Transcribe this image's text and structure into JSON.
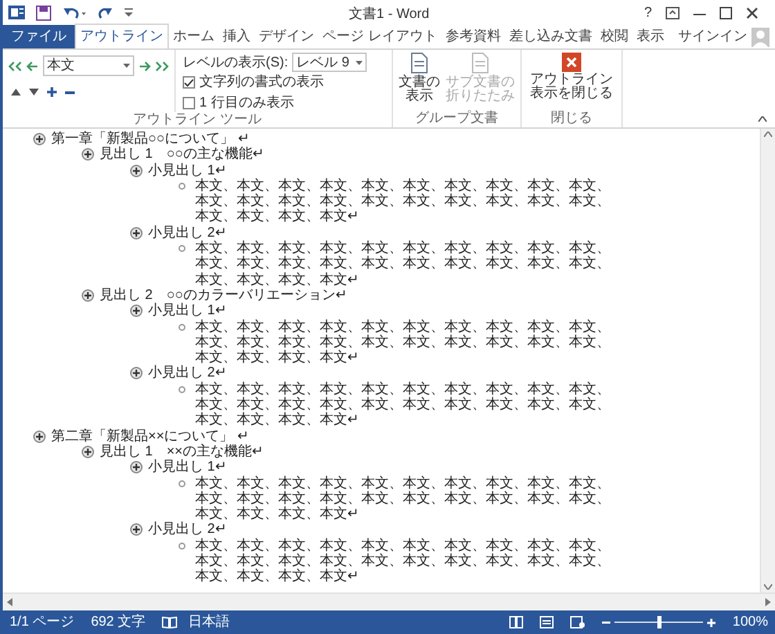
{
  "window": {
    "title": "文書1 - Word",
    "help": "?"
  },
  "tabs": [
    {
      "label": "ファイル",
      "kind": "file",
      "selected": false
    },
    {
      "label": "アウトライン",
      "kind": "tab",
      "selected": true
    },
    {
      "label": "ホーム",
      "kind": "tab",
      "selected": false
    },
    {
      "label": "挿入",
      "kind": "tab",
      "selected": false
    },
    {
      "label": "デザイン",
      "kind": "tab",
      "selected": false
    },
    {
      "label": "ページ レイアウト",
      "kind": "tab",
      "selected": false
    },
    {
      "label": "参考資料",
      "kind": "tab",
      "selected": false
    },
    {
      "label": "差し込み文書",
      "kind": "tab",
      "selected": false
    },
    {
      "label": "校閲",
      "kind": "tab",
      "selected": false
    },
    {
      "label": "表示",
      "kind": "tab",
      "selected": false
    }
  ],
  "account": {
    "label": "サインイン"
  },
  "outline_tools": {
    "level_dropdown": {
      "value": "本文"
    },
    "show_level": {
      "label": "レベルの表示(S):",
      "value": "レベル 9"
    },
    "checkboxes": [
      {
        "label": "文字列の書式の表示",
        "checked": true
      },
      {
        "label": "1 行目のみ表示",
        "checked": false
      }
    ],
    "group_label": "アウトライン ツール"
  },
  "master_document": {
    "buttons": [
      {
        "lines": [
          "文書の",
          "表示"
        ],
        "disabled": false
      },
      {
        "lines": [
          "サブ文書の",
          "折りたたみ"
        ],
        "disabled": true
      }
    ],
    "group_label": "グループ文書"
  },
  "close_group": {
    "button_lines": [
      "アウトライン",
      "表示を閉じる"
    ],
    "group_label": "閉じる"
  },
  "outline": [
    {
      "kind": "heading",
      "text": "第一章「新製品○○について」 ↵",
      "children": [
        {
          "kind": "heading",
          "text": "見出し 1　○○の主な機能↵",
          "children": [
            {
              "kind": "heading",
              "text": "小見出し 1↵",
              "children": [
                {
                  "kind": "body",
                  "text": "本文、本文、本文、本文、本文、本文、本文、本文、本文、本文、本文、本文、本文、本文、本文、本文、本文、本文、本文、本文、本文、本文、本文、本文↵"
                }
              ]
            },
            {
              "kind": "heading",
              "text": "小見出し 2↵",
              "children": [
                {
                  "kind": "body",
                  "text": "本文、本文、本文、本文、本文、本文、本文、本文、本文、本文、本文、本文、本文、本文、本文、本文、本文、本文、本文、本文、本文、本文、本文、本文↵"
                }
              ]
            }
          ]
        },
        {
          "kind": "heading",
          "text": "見出し 2　○○のカラーバリエーション↵",
          "children": [
            {
              "kind": "heading",
              "text": "小見出し 1↵",
              "children": [
                {
                  "kind": "body",
                  "text": "本文、本文、本文、本文、本文、本文、本文、本文、本文、本文、本文、本文、本文、本文、本文、本文、本文、本文、本文、本文、本文、本文、本文、本文↵"
                }
              ]
            },
            {
              "kind": "heading",
              "text": "小見出し 2↵",
              "children": [
                {
                  "kind": "body",
                  "text": "本文、本文、本文、本文、本文、本文、本文、本文、本文、本文、本文、本文、本文、本文、本文、本文、本文、本文、本文、本文、本文、本文、本文、本文↵"
                }
              ]
            }
          ]
        }
      ]
    },
    {
      "kind": "heading",
      "text": "第二章「新製品××について」 ↵",
      "children": [
        {
          "kind": "heading",
          "text": "見出し 1　××の主な機能↵",
          "children": [
            {
              "kind": "heading",
              "text": "小見出し 1↵",
              "children": [
                {
                  "kind": "body",
                  "text": "本文、本文、本文、本文、本文、本文、本文、本文、本文、本文、本文、本文、本文、本文、本文、本文、本文、本文、本文、本文、本文、本文、本文、本文↵"
                }
              ]
            },
            {
              "kind": "heading",
              "text": "小見出し 2↵",
              "children": [
                {
                  "kind": "body",
                  "text": "本文、本文、本文、本文、本文、本文、本文、本文、本文、本文、本文、本文、本文、本文、本文、本文、本文、本文、本文、本文、本文、本文、本文、本文↵"
                }
              ]
            }
          ]
        }
      ]
    }
  ],
  "status_bar": {
    "page": "1/1 ページ",
    "words": "692 文字",
    "language": "日本語",
    "zoom": "100%",
    "zoom_slider": {
      "level": 0.5
    }
  }
}
